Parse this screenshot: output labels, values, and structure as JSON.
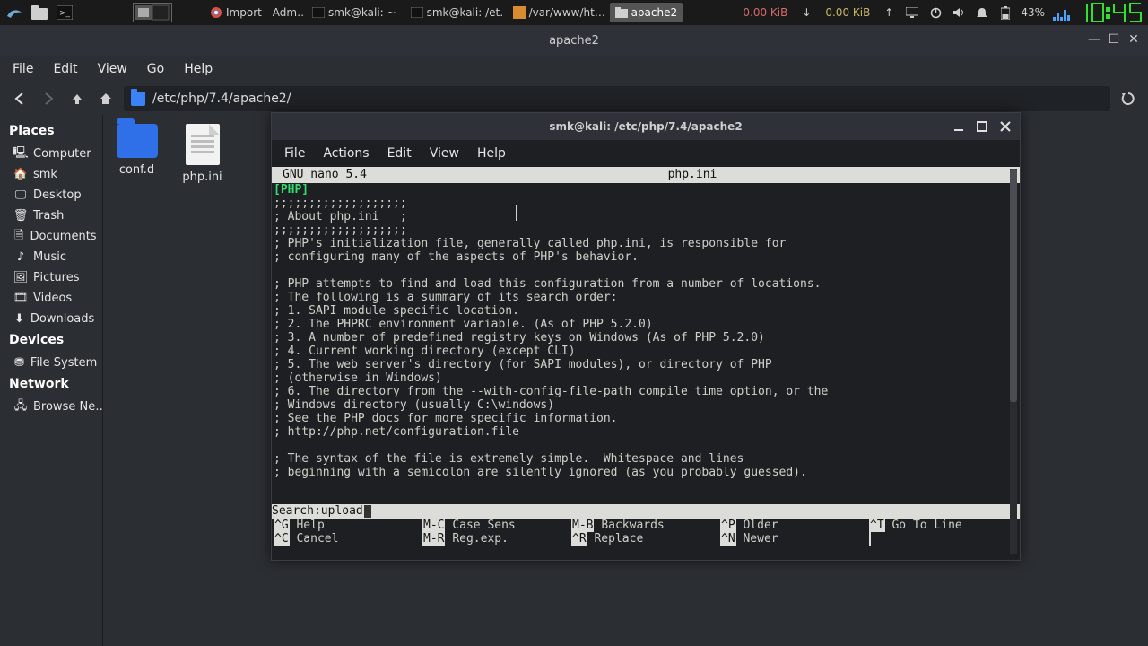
{
  "taskbar": {
    "apps": [
      {
        "label": "Import - Adm…"
      },
      {
        "label": "smk@kali: ~"
      },
      {
        "label": "smk@kali: /et…"
      },
      {
        "label": "/var/www/ht…"
      },
      {
        "label": "apache2",
        "active": true
      }
    ],
    "net_down": "0.00 KiB",
    "net_up": "0.00 KiB",
    "battery": "43%",
    "clock": "10:45"
  },
  "fm": {
    "title": "apache2",
    "menu": [
      "File",
      "Edit",
      "View",
      "Go",
      "Help"
    ],
    "path": "/etc/php/7.4/apache2/",
    "sidebar": {
      "places_head": "Places",
      "devices_head": "Devices",
      "network_head": "Network",
      "places": [
        "Computer",
        "smk",
        "Desktop",
        "Trash",
        "Documents",
        "Music",
        "Pictures",
        "Videos",
        "Downloads"
      ],
      "devices": [
        "File System"
      ],
      "network": [
        "Browse Ne…"
      ]
    },
    "files": [
      {
        "name": "conf.d",
        "type": "folder"
      },
      {
        "name": "php.ini",
        "type": "doc"
      }
    ]
  },
  "term": {
    "title": "smk@kali: /etc/php/7.4/apache2",
    "menu": [
      "File",
      "Actions",
      "Edit",
      "View",
      "Help"
    ],
    "nano_version": "GNU nano 5.4",
    "nano_file": "php.ini",
    "php_tag": "[PHP]",
    "content": "\n;;;;;;;;;;;;;;;;;;;\n; About php.ini   ;\n;;;;;;;;;;;;;;;;;;;\n; PHP's initialization file, generally called php.ini, is responsible for\n; configuring many of the aspects of PHP's behavior.\n\n; PHP attempts to find and load this configuration from a number of locations.\n; The following is a summary of its search order:\n; 1. SAPI module specific location.\n; 2. The PHPRC environment variable. (As of PHP 5.2.0)\n; 3. A number of predefined registry keys on Windows (As of PHP 5.2.0)\n; 4. Current working directory (except CLI)\n; 5. The web server's directory (for SAPI modules), or directory of PHP\n; (otherwise in Windows)\n; 6. The directory from the --with-config-file-path compile time option, or the\n; Windows directory (usually C:\\windows)\n; See the PHP docs for more specific information.\n; http://php.net/configuration.file\n\n; The syntax of the file is extremely simple.  Whitespace and lines\n; beginning with a semicolon are silently ignored (as you probably guessed).",
    "search_label": "Search: ",
    "search_value": "upload",
    "keys_row1": [
      {
        "k": "^G",
        "l": "Help"
      },
      {
        "k": "M-C",
        "l": "Case Sens"
      },
      {
        "k": "M-B",
        "l": "Backwards"
      },
      {
        "k": "^P",
        "l": "Older"
      },
      {
        "k": "^T",
        "l": "Go To Line"
      }
    ],
    "keys_row2": [
      {
        "k": "^C",
        "l": "Cancel"
      },
      {
        "k": "M-R",
        "l": "Reg.exp."
      },
      {
        "k": "^R",
        "l": "Replace"
      },
      {
        "k": "^N",
        "l": "Newer"
      },
      {
        "k": "",
        "l": ""
      }
    ]
  }
}
